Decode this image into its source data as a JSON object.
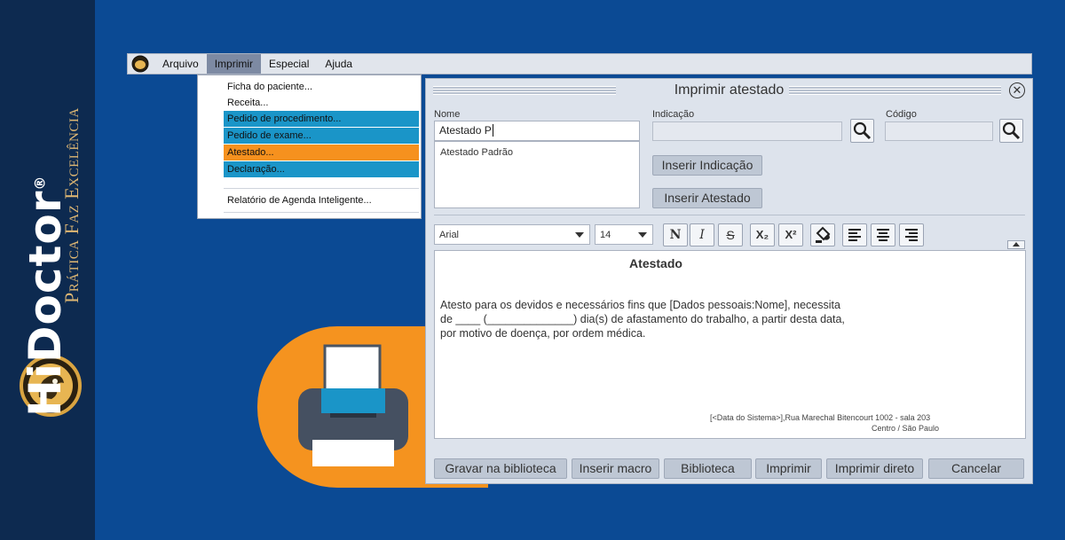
{
  "brand": {
    "name": "HiDoctor",
    "registered": "®",
    "tagline": "Prática Faz Excelência"
  },
  "menubar": {
    "items": [
      "Arquivo",
      "Imprimir",
      "Especial",
      "Ajuda"
    ],
    "active": "Imprimir"
  },
  "print_menu": {
    "items": [
      "Ficha do paciente...",
      "Receita...",
      "Pedido de procedimento...",
      "Pedido de exame...",
      "Atestado...",
      "Declaração...",
      "Relatório de Agenda Inteligente..."
    ],
    "highlighted": "Atestado..."
  },
  "dialog": {
    "title": "Imprimir atestado",
    "nome_label": "Nome",
    "nome_value": "Atestado P",
    "list_items": [
      "Atestado Padrão"
    ],
    "indicacao_label": "Indicação",
    "codigo_label": "Código",
    "inserir_indicacao": "Inserir Indicação",
    "inserir_atestado": "Inserir Atestado",
    "font_family": "Arial",
    "font_size": "14",
    "format_buttons": {
      "bold": "N",
      "italic": "I",
      "strike": "S",
      "subscript": "X₂",
      "superscript": "X²"
    },
    "document": {
      "title": "Atestado",
      "lines": [
        "Atesto para os devidos e necessários fins que [Dados pessoais:Nome], necessita",
        "de ____ (______________) dia(s) de afastamento do trabalho, a partir desta data,",
        "por motivo de doença, por ordem médica."
      ],
      "footer_line1": "[<Data do Sistema>],Rua Marechal Bitencourt 1002 - sala 203",
      "footer_line2": "Centro / São Paulo"
    },
    "buttons": {
      "gravar": "Gravar na biblioteca",
      "macro": "Inserir macro",
      "biblioteca": "Biblioteca",
      "imprimir": "Imprimir",
      "imprimir_direto": "Imprimir direto",
      "cancelar": "Cancelar"
    }
  },
  "colors": {
    "background": "#0b4a94",
    "strip": "#0d2a50",
    "accent_orange": "#f5931f",
    "menu_highlight": "#1a95c8"
  },
  "icons": [
    "hidoctor-logo-icon",
    "search-icon",
    "printer-icon",
    "paint-bucket-icon",
    "align-left-icon",
    "align-center-icon",
    "align-right-icon",
    "close-icon"
  ]
}
